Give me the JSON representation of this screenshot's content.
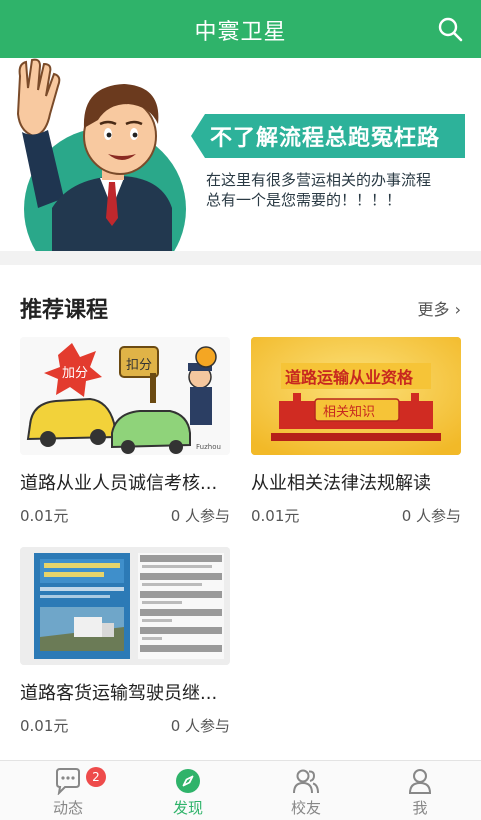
{
  "header": {
    "title": "中寰卫星",
    "search_icon": "search-icon"
  },
  "banner": {
    "headline": "不了解流程总跑冤枉路",
    "subtitle_line1": "在这里有很多营运相关的办事流程",
    "subtitle_line2": "总有一个是您需要的！！！！"
  },
  "section": {
    "title": "推荐课程",
    "more_label": "更多 ›"
  },
  "courses": [
    {
      "name": "道路从业人员诚信考核...",
      "price": "0.01元",
      "participants": "0 人参与",
      "thumb": "cartoon-traffic-illustration",
      "thumb_text_1": "加分",
      "thumb_text_2": "扣分"
    },
    {
      "name": "从业相关法律法规解读",
      "price": "0.01元",
      "participants": "0 人参与",
      "thumb": "road-transport-banner",
      "thumb_text_1": "道路运输从业资格",
      "thumb_text_2": "相关知识"
    },
    {
      "name": "道路客货运输驾驶员继...",
      "price": "0.01元",
      "participants": "0 人参与",
      "thumb": "book-cover-photo"
    }
  ],
  "tabs": [
    {
      "label": "动态",
      "icon": "chat-icon",
      "badge": "2"
    },
    {
      "label": "发现",
      "icon": "compass-icon"
    },
    {
      "label": "校友",
      "icon": "people-icon"
    },
    {
      "label": "我",
      "icon": "person-icon"
    }
  ],
  "colors": {
    "primary": "#2fb36a",
    "badge": "#ee4b4b",
    "banner_teal": "#2db29a"
  }
}
